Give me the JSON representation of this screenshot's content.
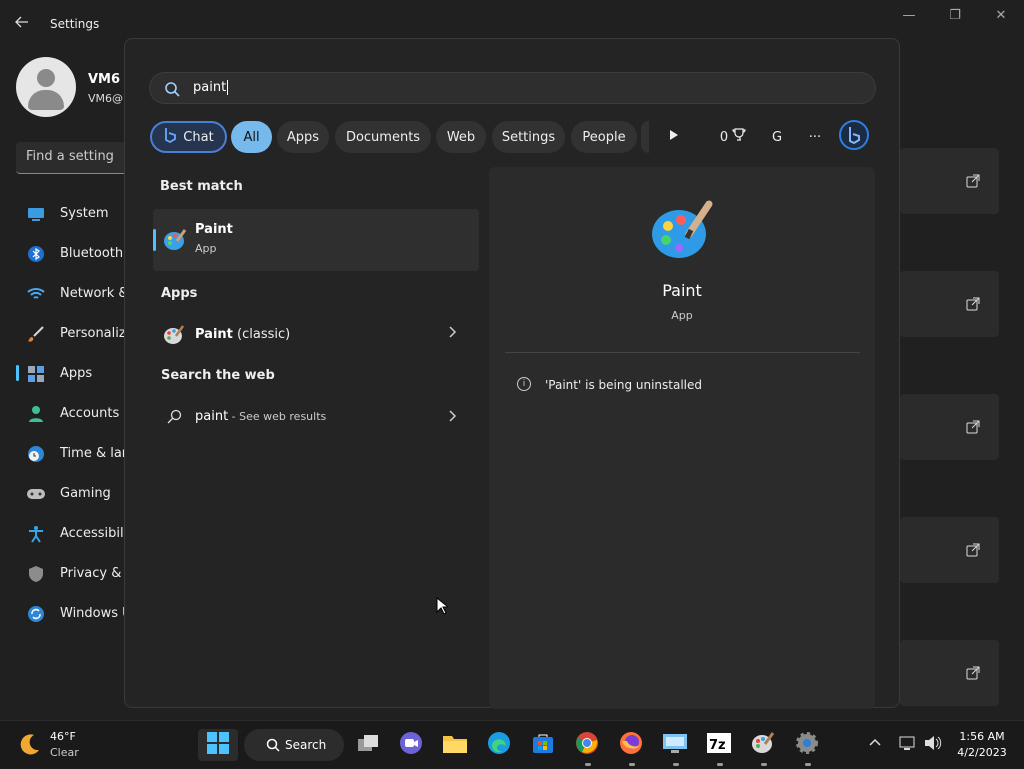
{
  "settings": {
    "title": "Settings",
    "user": {
      "name": "VM6",
      "email": "VM6@"
    },
    "find_placeholder": "Find a setting",
    "nav": [
      {
        "label": "System",
        "icon": "monitor-icon"
      },
      {
        "label": "Bluetooth",
        "icon": "bluetooth-icon"
      },
      {
        "label": "Network &",
        "icon": "wifi-icon"
      },
      {
        "label": "Personaliza",
        "icon": "brush-icon"
      },
      {
        "label": "Apps",
        "icon": "apps-icon"
      },
      {
        "label": "Accounts",
        "icon": "person-icon"
      },
      {
        "label": "Time & lan",
        "icon": "clock-globe-icon"
      },
      {
        "label": "Gaming",
        "icon": "gamepad-icon"
      },
      {
        "label": "Accessibili",
        "icon": "accessibility-icon"
      },
      {
        "label": "Privacy & s",
        "icon": "shield-icon"
      },
      {
        "label": "Windows U",
        "icon": "update-icon"
      }
    ]
  },
  "search": {
    "query": "paint",
    "chips": {
      "chat": "Chat",
      "all": "All",
      "apps": "Apps",
      "documents": "Documents",
      "web": "Web",
      "settings": "Settings",
      "people": "People"
    },
    "rewards_count": "0",
    "account_initial": "G",
    "more": "···",
    "best_match_heading": "Best match",
    "best_match": {
      "name": "Paint",
      "type": "App"
    },
    "apps_heading": "Apps",
    "apps": [
      {
        "name": "Paint",
        "suffix": " (classic)"
      }
    ],
    "web_heading": "Search the web",
    "web_result": {
      "query": "paint",
      "suffix": " - See web results"
    },
    "preview": {
      "name": "Paint",
      "type": "App",
      "info": "'Paint' is being uninstalled"
    }
  },
  "taskbar": {
    "weather": {
      "temp": "46°F",
      "condition": "Clear"
    },
    "search_label": "Search",
    "clock": {
      "time": "1:56 AM",
      "date": "4/2/2023"
    }
  },
  "colors": {
    "accent": "#4cc2ff",
    "all_chip": "#76b9ed",
    "chat_border": "#4a7fd4"
  }
}
